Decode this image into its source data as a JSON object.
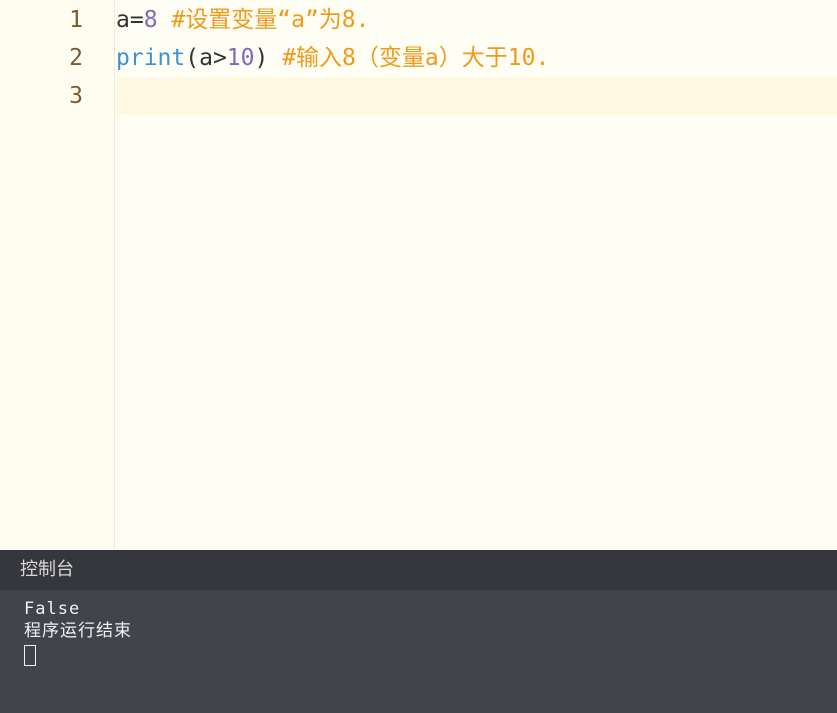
{
  "editor": {
    "lines": [
      {
        "number": "1",
        "tokens": [
          {
            "text": "a=",
            "type": "plain"
          },
          {
            "text": "8",
            "type": "num"
          },
          {
            "text": " ",
            "type": "plain"
          },
          {
            "text": "#设置变量“a”为8.",
            "type": "comment"
          }
        ]
      },
      {
        "number": "2",
        "tokens": [
          {
            "text": "print",
            "type": "builtin"
          },
          {
            "text": "(a>",
            "type": "plain"
          },
          {
            "text": "10",
            "type": "num"
          },
          {
            "text": ") ",
            "type": "plain"
          },
          {
            "text": "#输入8（变量a）大于10.",
            "type": "comment"
          }
        ]
      },
      {
        "number": "3",
        "tokens": []
      }
    ],
    "active_line": 3
  },
  "console": {
    "title": "控制台",
    "output": [
      "False",
      "程序运行结束"
    ]
  },
  "colors": {
    "editor_bg": "#fffef5",
    "gutter_bg": "#fffcf0",
    "active_line_bg": "#fff8e3",
    "line_number": "#7a5a2e",
    "number_literal": "#7b6bb8",
    "builtin": "#3f92cf",
    "comment": "#f09a1a",
    "console_header_bg": "#35373c",
    "console_bg": "#41444a"
  }
}
